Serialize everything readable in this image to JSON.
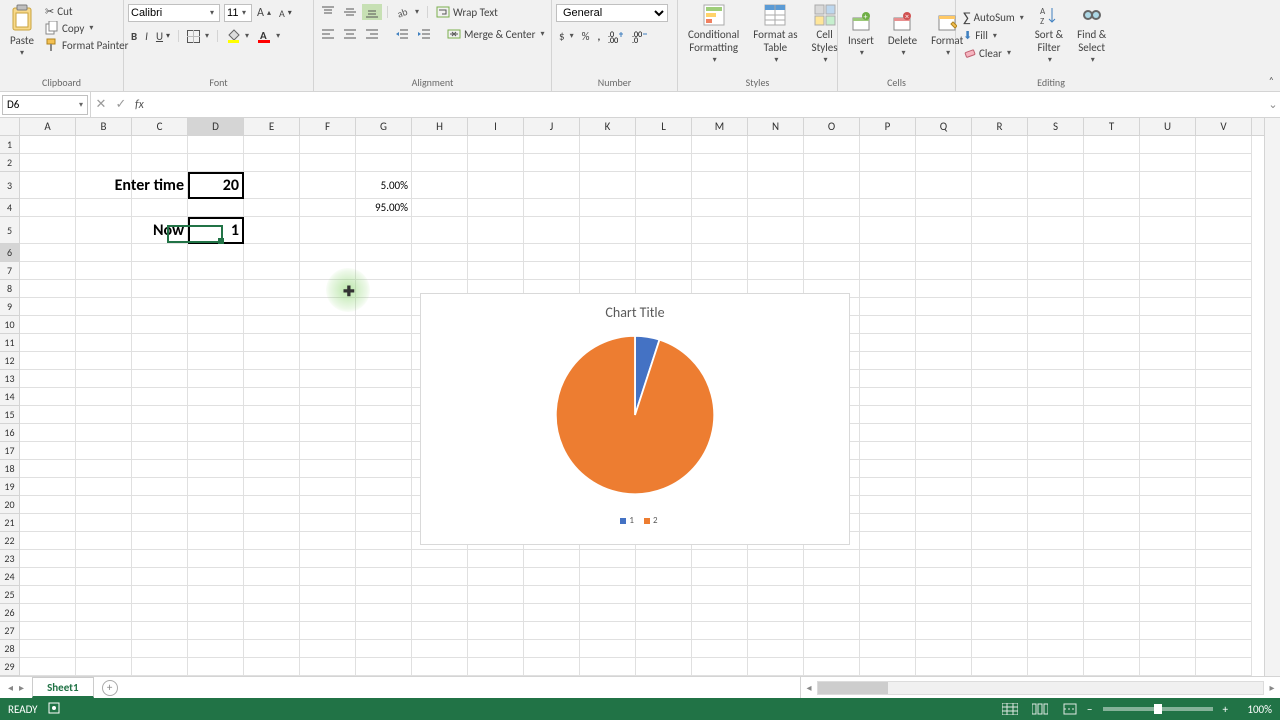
{
  "ribbon": {
    "clipboard": {
      "paste": "Paste",
      "cut": "Cut",
      "copy": "Copy",
      "format_painter": "Format Painter",
      "group_label": "Clipboard"
    },
    "font": {
      "font_name": "Calibri",
      "font_size": "11",
      "group_label": "Font"
    },
    "alignment": {
      "wrap": "Wrap Text",
      "merge": "Merge & Center",
      "group_label": "Alignment"
    },
    "number": {
      "format": "General",
      "group_label": "Number"
    },
    "styles": {
      "conditional": "Conditional\nFormatting",
      "format_table": "Format as\nTable",
      "cell_styles": "Cell\nStyles",
      "group_label": "Styles"
    },
    "cells": {
      "insert": "Insert",
      "delete": "Delete",
      "format": "Format",
      "group_label": "Cells"
    },
    "editing": {
      "autosum": "AutoSum",
      "fill": "Fill",
      "clear": "Clear",
      "sort": "Sort &\nFilter",
      "find": "Find &\nSelect",
      "group_label": "Editing"
    }
  },
  "namebox": "D6",
  "formula": "",
  "columns": [
    "A",
    "B",
    "C",
    "D",
    "E",
    "F",
    "G",
    "H",
    "I",
    "J",
    "K",
    "L",
    "M",
    "N",
    "O",
    "P",
    "Q",
    "R",
    "S",
    "T",
    "U",
    "V"
  ],
  "rows_count": 29,
  "tall_rows": [
    3,
    5
  ],
  "selected_col": "D",
  "selected_row": 6,
  "cells": {
    "C3": {
      "text": "Enter time",
      "cls": "big-bold right",
      "overflow_left": true
    },
    "D3": {
      "text": "20",
      "cls": "big-bold right bordered"
    },
    "G3": {
      "text": "5.00%",
      "cls": "right"
    },
    "G4": {
      "text": "95.00%",
      "cls": "right"
    },
    "C5": {
      "text": "Now",
      "cls": "big-bold right"
    },
    "D5": {
      "text": "1",
      "cls": "big-bold right bordered"
    }
  },
  "chart_data": {
    "type": "pie",
    "title": "Chart Title",
    "series": [
      {
        "name": "1",
        "value": 5.0,
        "color": "#4472C4"
      },
      {
        "name": "2",
        "value": 95.0,
        "color": "#ED7D31"
      }
    ],
    "legend": [
      "1",
      "2"
    ]
  },
  "sheet_tab": "Sheet1",
  "status": "READY",
  "zoom": "100%"
}
